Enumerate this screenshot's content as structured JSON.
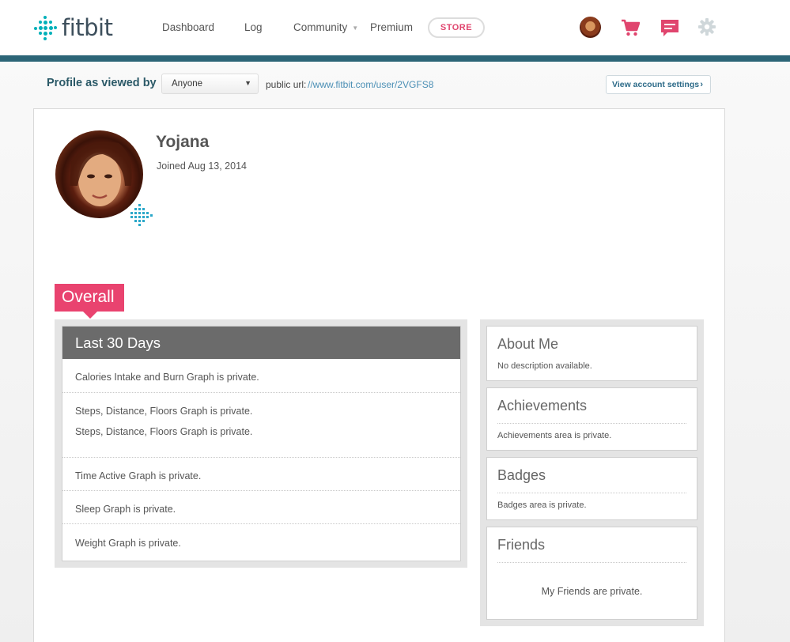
{
  "header": {
    "brand": "fitbit",
    "nav": {
      "dashboard": "Dashboard",
      "log": "Log",
      "community": "Community",
      "premium": "Premium",
      "store": "STORE"
    },
    "icons": [
      "avatar",
      "cart-icon",
      "messages-icon",
      "gear-icon"
    ],
    "colors": {
      "brand_teal": "#00b0b9",
      "accent_pink": "#e0456e",
      "stripe": "#2c6577"
    }
  },
  "profile_bar": {
    "viewed_by_label": "Profile as viewed by",
    "viewed_by_value": "Anyone",
    "public_url_label": "public url:",
    "public_url": "//www.fitbit.com/user/2VGFS8",
    "account_settings": "View account settings"
  },
  "profile": {
    "name": "Yojana",
    "joined": "Joined Aug 13, 2014"
  },
  "overall": {
    "tag": "Overall",
    "panel_title": "Last 30 Days",
    "rows": {
      "calories": "Calories Intake and Burn Graph is private.",
      "steps_1": "Steps, Distance, Floors Graph is private.",
      "steps_2": "Steps, Distance, Floors Graph is private.",
      "time_active": "Time Active Graph is private.",
      "sleep": "Sleep Graph is private.",
      "weight": "Weight Graph is private."
    }
  },
  "sidebar": {
    "about_title": "About Me",
    "about_text": "No description available.",
    "achievements_title": "Achievements",
    "achievements_text": "Achievements area is private.",
    "badges_title": "Badges",
    "badges_text": "Badges area is private.",
    "friends_title": "Friends",
    "friends_text": "My Friends are private."
  }
}
